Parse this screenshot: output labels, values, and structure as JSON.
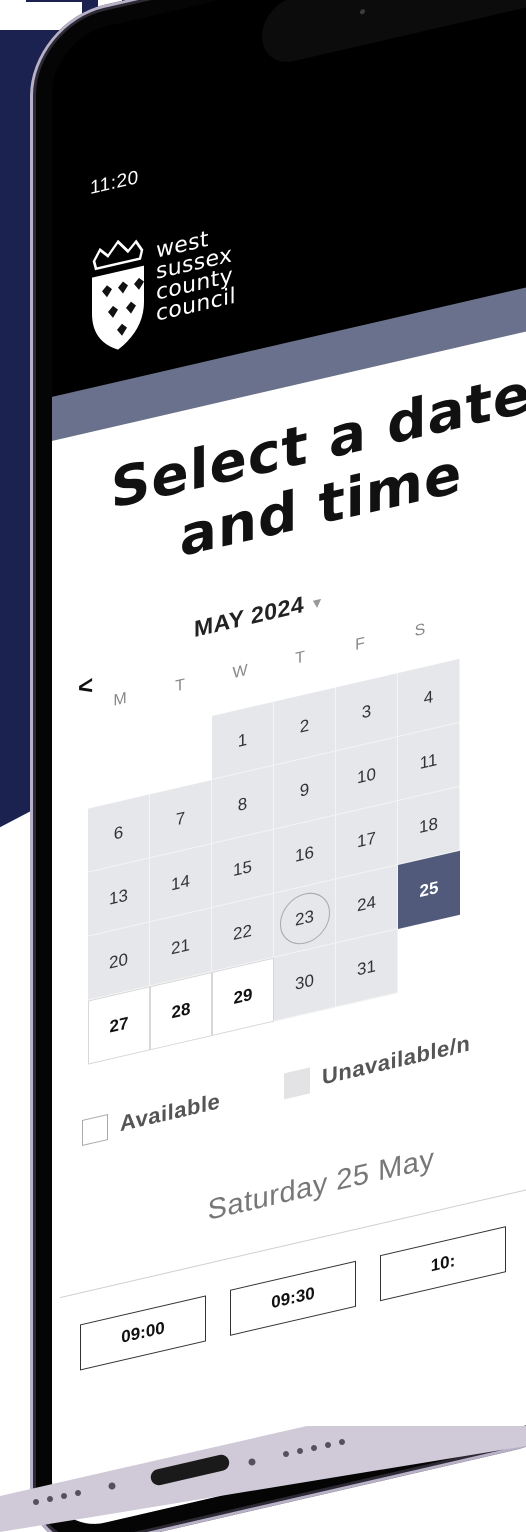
{
  "status": {
    "time": "11:20"
  },
  "council": {
    "logo_lines": [
      "west",
      "sussex",
      "county",
      "council"
    ]
  },
  "page": {
    "title_lines": [
      "Select a date",
      "and time"
    ]
  },
  "calendar": {
    "month": "MAY 2024",
    "weekdays": [
      "M",
      "T",
      "W",
      "T",
      "F",
      "S"
    ],
    "unavailable_days": [
      1,
      2,
      3,
      4,
      6,
      7,
      8,
      9,
      10,
      11,
      13,
      14,
      15,
      16,
      17,
      18,
      20,
      21,
      22,
      23,
      24,
      30,
      31
    ],
    "available_days": [
      27,
      28,
      29
    ],
    "selected_day": 25,
    "today": 23
  },
  "legend": {
    "available": "Available",
    "unavailable": "Unavailable/n"
  },
  "selected_date_heading": "Saturday 25 May",
  "time_slots": [
    "09:00",
    "09:30",
    "10:"
  ],
  "colors": {
    "backdrop": "#1c2250",
    "header_strip": "#69718d",
    "selected_day": "#525a7c",
    "unavailable_day": "#e6e7ea"
  },
  "icons": [
    "chevron-left-icon",
    "chevron-down-icon",
    "council-crest-icon"
  ]
}
